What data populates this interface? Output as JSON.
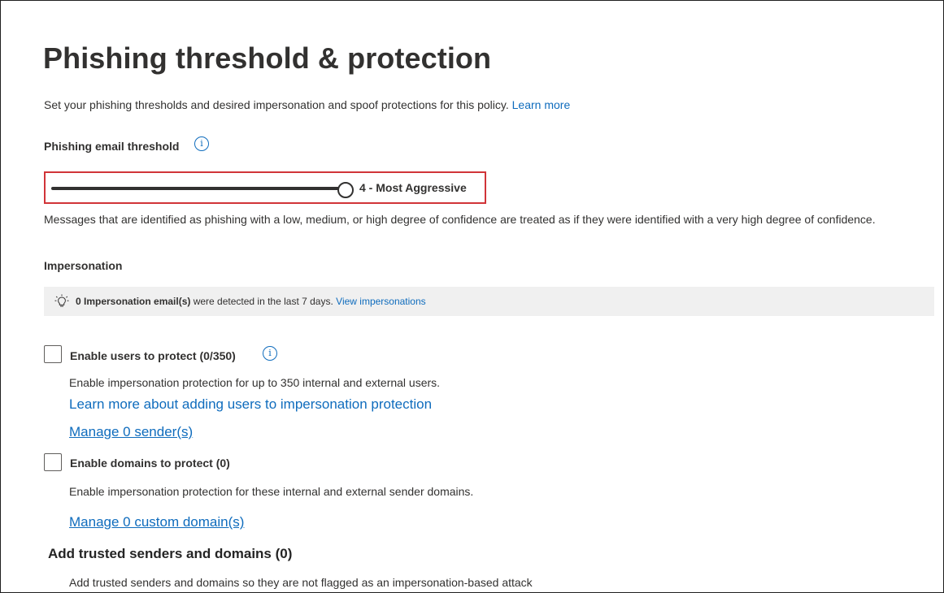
{
  "page": {
    "title": "Phishing threshold & protection",
    "intro": "Set your phishing thresholds and desired impersonation and spoof protections for this policy.",
    "learn_more": "Learn more"
  },
  "threshold": {
    "label": "Phishing email threshold",
    "info_icon": "info-icon",
    "value_label": "4 - Most Aggressive",
    "value": 4,
    "max": 4,
    "description": "Messages that are identified as phishing with a low, medium, or high degree of confidence are treated as if they were identified with a very high degree of confidence.",
    "highlight_color": "#d13438"
  },
  "impersonation": {
    "label": "Impersonation",
    "notice": {
      "icon": "lightbulb-icon",
      "bold": "0 Impersonation email(s)",
      "text": " were detected in the last 7 days.",
      "link": "View impersonations"
    },
    "users": {
      "checked": false,
      "label": "Enable users to protect (0/350)",
      "description": "Enable impersonation protection for up to 350 internal and external users.",
      "learn_link": "Learn more about adding users to impersonation protection",
      "manage_link": "Manage 0 sender(s)"
    },
    "domains": {
      "checked": false,
      "label": "Enable domains to protect (0)",
      "description": "Enable impersonation protection for these internal and external sender domains.",
      "manage_link": "Manage 0 custom domain(s)"
    }
  },
  "trusted": {
    "heading": "Add trusted senders and domains (0)",
    "description": "Add trusted senders and domains so they are not flagged as an impersonation-based attack"
  },
  "colors": {
    "link": "#0f6cbd",
    "text": "#323130",
    "notice_bg": "#f0f0f0"
  }
}
